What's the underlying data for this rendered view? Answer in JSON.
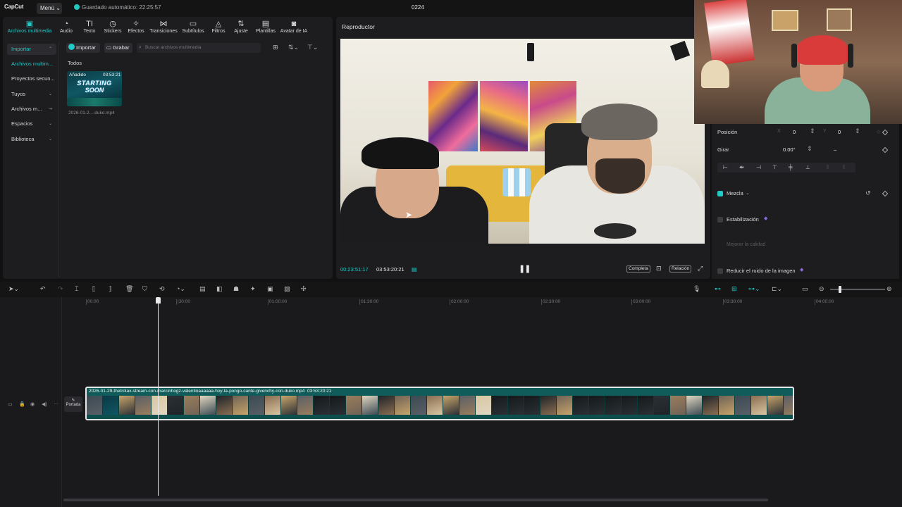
{
  "titlebar": {
    "logo": "CapCut",
    "menu": "Menú",
    "autosave": "Guardado automático: 22:25:57",
    "project_title": "0224"
  },
  "toolbar_tabs": [
    {
      "label": "Archivos multimedia",
      "icon": "media-icon",
      "glyph": "▣",
      "active": true
    },
    {
      "label": "Audio",
      "icon": "audio-icon",
      "glyph": "◔"
    },
    {
      "label": "Texto",
      "icon": "text-icon",
      "glyph": "TI"
    },
    {
      "label": "Stickers",
      "icon": "sticker-icon",
      "glyph": "◷"
    },
    {
      "label": "Efectos",
      "icon": "effects-icon",
      "glyph": "✧"
    },
    {
      "label": "Transiciones",
      "icon": "transition-icon",
      "glyph": "⋈"
    },
    {
      "label": "Subtítulos",
      "icon": "subtitles-icon",
      "glyph": "▭"
    },
    {
      "label": "Filtros",
      "icon": "filters-icon",
      "glyph": "◬"
    },
    {
      "label": "Ajuste",
      "icon": "adjust-icon",
      "glyph": "⇅"
    },
    {
      "label": "Plantillas",
      "icon": "templates-icon",
      "glyph": "▤"
    },
    {
      "label": "Avatar de IA",
      "icon": "ai-avatar-icon",
      "glyph": "◙"
    }
  ],
  "side_nav": [
    {
      "label": "Importar",
      "highlight": true,
      "cyan": true,
      "arrow": "⌃"
    },
    {
      "label": "Archivos multim...",
      "cyan": true
    },
    {
      "label": "Proyectos secun..."
    },
    {
      "label": "Tuyos",
      "arrow": "⌄"
    },
    {
      "label": "Archivos m...",
      "arrow": "⇝"
    },
    {
      "label": "Espacios",
      "arrow": "⌄"
    },
    {
      "label": "Biblioteca",
      "arrow": "⌄"
    }
  ],
  "media": {
    "import_label": "Importar",
    "record_label": "Grabar",
    "search_placeholder": "Buscar archivos multimedia",
    "filter_label": "Todos",
    "item": {
      "added_label": "Añadido",
      "duration": "03:53:21",
      "name": "2026-01-2...-duko.mp4",
      "thumb_line1": "STARTING",
      "thumb_line2": "SOON"
    }
  },
  "player": {
    "title": "Reproductor",
    "current_time": "00:23:51:17",
    "total_time": "03:53:20:21",
    "full_label": "Completa",
    "ratio_label": "Relación"
  },
  "properties": {
    "position_label": "Posición",
    "x_label": "X",
    "x_value": "0",
    "y_label": "Y",
    "y_value": "0",
    "rotate_label": "Girar",
    "rotate_value": "0.00°",
    "blend_label": "Mezcla",
    "stabilize_label": "Estabilización",
    "enhance_label": "Mejorar la calidad",
    "denoise_label": "Reducir el ruido de la imagen"
  },
  "timeline": {
    "ruler": [
      "00:00",
      "|30:00",
      "01:00:00",
      "01:30:00",
      "02:00:00",
      "02:30:00",
      "03:00:00",
      "03:30:00",
      "04:00:00"
    ],
    "clip_label": "2026-01-29-thetrolax-stream-con-marcinhogz-valentinaaaaaa-hoy-la-pongo-cante-givenchy-con-duko.mp4",
    "clip_duration": "03:53:20:21",
    "cover_label": "Portada"
  },
  "colors": {
    "accent": "#22c9c6",
    "clip": "#0f5c5a",
    "panel": "#1d1d1f"
  }
}
